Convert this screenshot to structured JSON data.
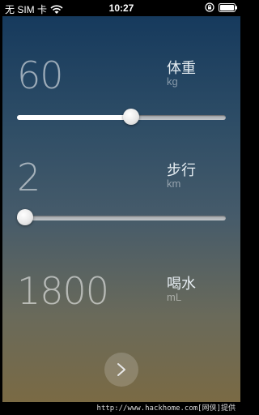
{
  "status_bar": {
    "carrier": "无 SIM 卡",
    "time": "10:27",
    "icons": [
      "wifi-icon",
      "rotation-lock-icon",
      "battery-icon"
    ]
  },
  "metrics": [
    {
      "id": "weight",
      "value": "60",
      "label": "体重",
      "unit": "kg",
      "has_slider": true,
      "slider_fraction": 0.55
    },
    {
      "id": "steps",
      "value": "2",
      "label": "步行",
      "unit": "km",
      "has_slider": true,
      "slider_fraction": 0.0
    },
    {
      "id": "water",
      "value": "1800",
      "label": "喝水",
      "unit": "mL",
      "has_slider": false
    }
  ],
  "next_button": {
    "icon": "chevron-right-icon"
  },
  "watermark": "http://www.hackhome.com[网侠]提供",
  "colors": {
    "bg_top": "#163a5d",
    "bg_bottom": "#7a6a44",
    "slider_fill": "#ffffff"
  }
}
